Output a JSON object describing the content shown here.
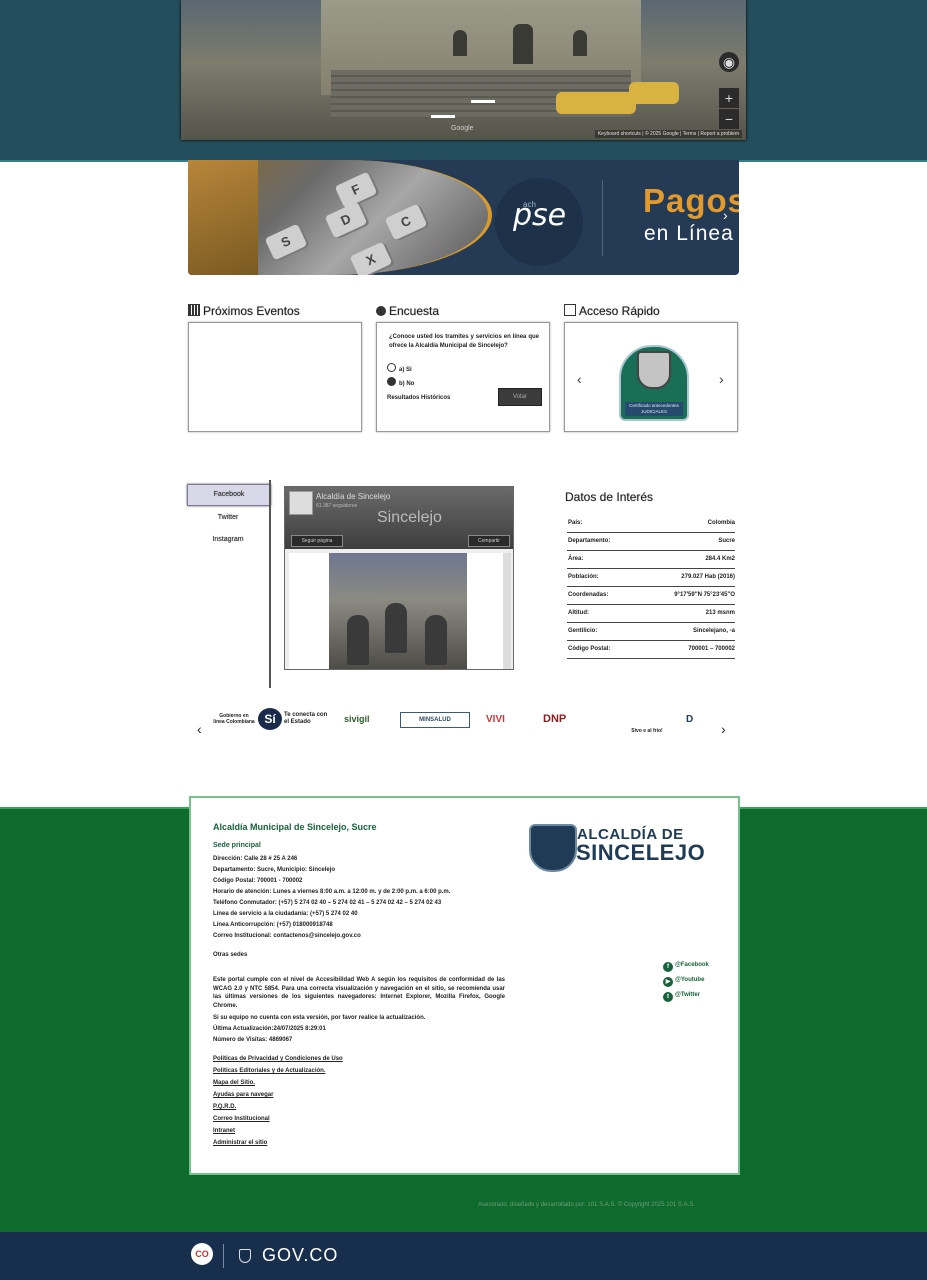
{
  "streetview": {
    "attribution": "Keyboard shortcuts | © 2025 Google | Terms | Report a problem",
    "google_logo": "Google"
  },
  "banner": {
    "pse_small": "ach",
    "pse_text": "pse",
    "title_line1": "Pagos",
    "title_line2": "en Línea",
    "keys": [
      "S",
      "D",
      "F",
      "X",
      "C"
    ]
  },
  "widgets": {
    "eventos": {
      "title": "Próximos Eventos"
    },
    "encuesta": {
      "title": "Encuesta",
      "question": "¿Conoce usted los tramites y servicios en línea que ofrece la Alcaldía Municipal de Sincelejo?",
      "options": [
        "a) Si",
        "b) No"
      ],
      "results_link": "Resultados Históricos",
      "vote_button": "Votar"
    },
    "acceso": {
      "title": "Acceso Rápido",
      "badge_label": "Certificado antecedentes JUDICIALES"
    }
  },
  "social": {
    "tabs": [
      "Facebook",
      "Twitter",
      "Instagram"
    ],
    "facebook": {
      "page_name": "Alcaldía de Sincelejo",
      "followers": "61.387 seguidores",
      "cover_text": "Sincelejo",
      "follow_button": "Seguir página",
      "share_button": "Compartir"
    }
  },
  "datos": {
    "title": "Datos de Interés",
    "rows": [
      {
        "k": "País:",
        "v": "Colombia"
      },
      {
        "k": "Departamento:",
        "v": "Sucre"
      },
      {
        "k": "Área:",
        "v": "284.4 Km2"
      },
      {
        "k": "Población:",
        "v": "279.027 Hab (2016)"
      },
      {
        "k": "Coordenadas:",
        "v": "9°17′59″N 75°23′45″O"
      },
      {
        "k": "Altitud:",
        "v": "213 msnm"
      },
      {
        "k": "Gentilicio:",
        "v": "Sincelejano, -a"
      },
      {
        "k": "Código Postal:",
        "v": "700001 – 700002"
      }
    ]
  },
  "logos": {
    "items": [
      "Gobierno en línea Colombiana",
      "Sí",
      "Te conecta con el Estado",
      "sivigil",
      "MINSALUD",
      "VIVI",
      "DNP",
      "Sivo e al frío!",
      "D"
    ]
  },
  "footer": {
    "title": "Alcaldía Municipal de Sincelejo, Sucre",
    "sede": "Sede principal",
    "lines": [
      "Dirección: Calle 28 # 25 A 246",
      "Departamento: Sucre, Municipio: Sincelejo",
      "Código Postal: 700001 - 700002",
      "Horario de atención: Lunes a viernes 8:00 a.m. a 12:00 m. y de 2:00 p.m. a 6:00 p.m.",
      "Teléfono Conmutador: (+57) 5 274 02 40 – 5 274 02 41 – 5 274 02 42 – 5 274 02 43",
      "Línea de servicio a la ciudadanía: (+57) 5 274 02 40",
      "Línea Anticorrupción: (+57) 018000918748",
      "Correo Institucional: contactenos@sincelejo.gov.co"
    ],
    "otras_sedes": "Otras sedes",
    "accessibility": "Este portal cumple con el nivel de Accesibilidad Web A según los requisitos de conformidad de las WCAG 2.0 y NTC 5854. Para una correcta visualización y navegación en el sitio, se recomienda usar las últimas versiones de los siguientes navegadores: Internet Explorer, Mozilla Firefox, Google Chrome.",
    "update_note": "Si su equipo no cuenta con esta versión, por favor realice la actualización.",
    "last_update": "Última Actualización:24/07/2025 8:29:01",
    "visits": "Número de Visitas: 4869067",
    "links": [
      "Políticas de Privacidad y Condiciones de Uso",
      "Políticas Editoriales y de Actualización.",
      "Mapa del Sitio.",
      " Ayudas para navegar",
      "P.Q.R.D.",
      "Correo Institucional",
      "Intranet",
      "Administrar el sitio"
    ],
    "logo_line1": "ALCALDÍA DE",
    "logo_line2": "SINCELEJO",
    "social": [
      "@Facebook",
      "@Youtube",
      "@Twitter"
    ],
    "credit": "Asesorado, diseñado y desarrollado por: 101 S.A.S. © Copyright 2025 101 S.A.S."
  },
  "govbar": {
    "co": "CO",
    "text": "GOV.CO"
  }
}
